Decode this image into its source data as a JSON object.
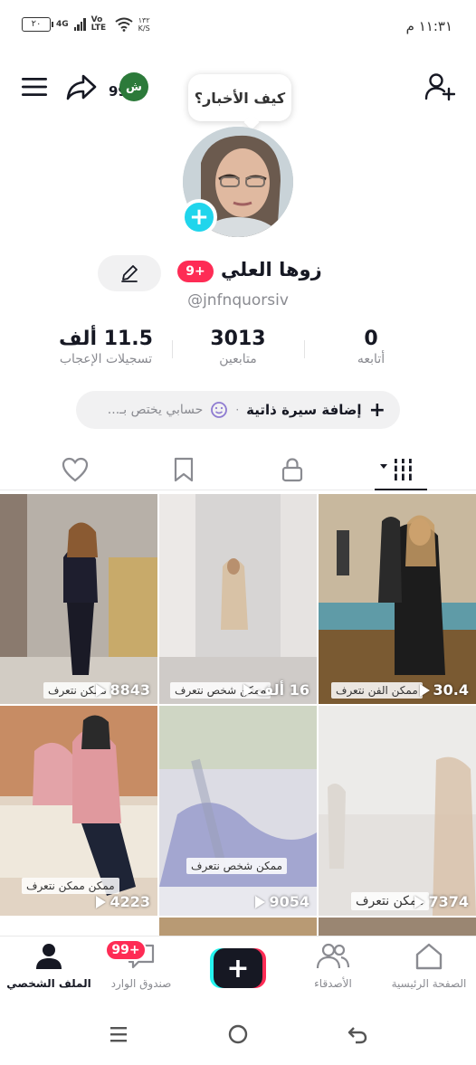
{
  "status_bar": {
    "time": "١١:٣١ م",
    "battery": "٢٠",
    "network": "4G",
    "volte": "Vo LTE",
    "speed_value": "١٣٢",
    "speed_unit": "K/S"
  },
  "header": {
    "notification_badge_letters": "ش",
    "notification_badge_count": "99",
    "status_bubble": "كيف الأخبار؟"
  },
  "profile": {
    "display_name": "زوها العلي",
    "badge": "9+",
    "username": "@jnfnquorsiv",
    "stats": [
      {
        "value": "0",
        "label": "أتابعه"
      },
      {
        "value": "3013",
        "label": "متابعين"
      },
      {
        "value": "11.5 ألف",
        "label": "تسجيلات الإعجاب"
      }
    ],
    "bio_button": "إضافة سيرة ذاتية",
    "bio_hint": "حسابي يختص بـ..."
  },
  "videos": [
    {
      "views": "30.4",
      "caption": "ممكن الفن نتعرف"
    },
    {
      "views": "16 ألف",
      "caption": "ممكن شخص نتعرف"
    },
    {
      "views": "8843",
      "caption": "ممكن نتعرف"
    },
    {
      "views": "7374",
      "caption": "ممكن نتعرف"
    },
    {
      "views": "9054",
      "caption": "ممكن شخص نتعرف"
    },
    {
      "views": "4223",
      "caption": "ممكن ممكن نتعرف"
    }
  ],
  "bottom_nav": {
    "home": "الصفحة الرئيسية",
    "friends": "الأصدقاء",
    "inbox": "صندوق الوارد",
    "inbox_badge": "99+",
    "profile": "الملف الشخصي"
  },
  "colors": {
    "accent_red": "#fe2c55",
    "accent_cyan": "#25f4ee",
    "text_primary": "#161823",
    "text_secondary": "#8a8b91"
  }
}
